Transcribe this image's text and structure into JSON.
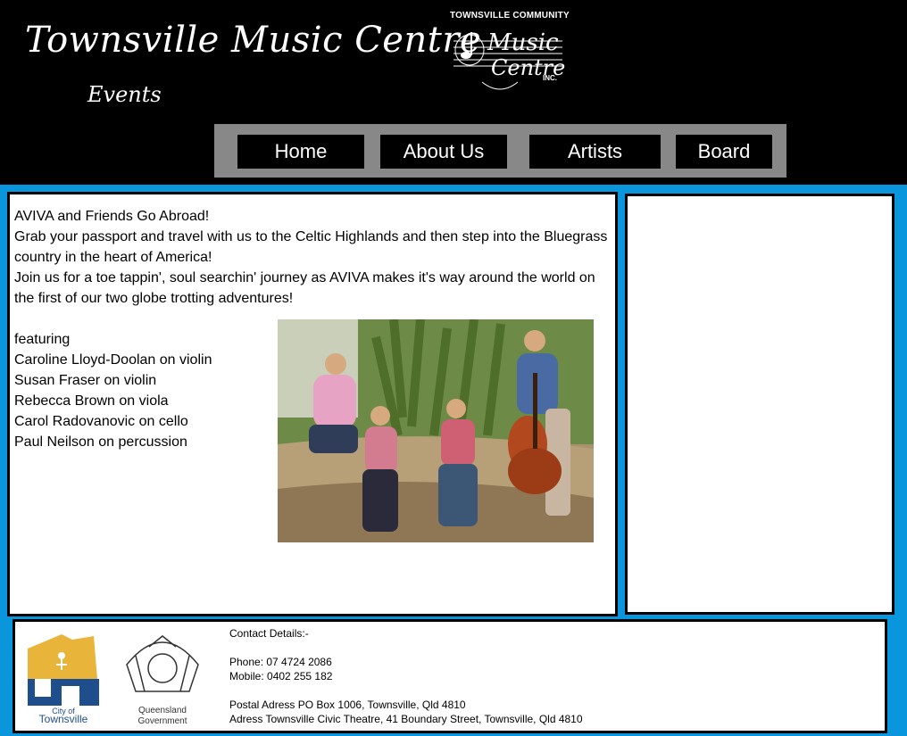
{
  "header": {
    "title": "Townsville Music Centre",
    "subtitle": "Events",
    "logo": {
      "top_text": "TOWNSVILLE COMMUNITY",
      "line1": "Music",
      "line2": "Centre",
      "suffix": "INC."
    }
  },
  "nav": {
    "items": [
      {
        "label": "Home"
      },
      {
        "label": "About Us"
      },
      {
        "label": "Artists"
      },
      {
        "label": "Board"
      }
    ]
  },
  "main": {
    "lines": [
      "AVIVA and Friends Go Abroad!",
      "Grab your passport and travel with us to the Celtic Highlands and then step into the Bluegrass country in the heart of America!",
      "Join us for a toe tappin', soul searchin' journey as AVIVA makes it's way around the world on the first of our two globe trotting adventures!"
    ],
    "featuring_label": "featuring",
    "performers": [
      "Caroline Lloyd-Doolan on violin",
      "Susan Fraser on violin",
      "Rebecca Brown on viola",
      "Carol Radovanovic on cello",
      "Paul Neilson on percussion"
    ]
  },
  "footer": {
    "contact_heading": "Contact Details:-",
    "phone": "Phone: 07 4724 2086",
    "mobile": "Mobile: 0402 255 182",
    "postal": "Postal Adress PO Box 1006, Townsville, Qld 4810",
    "address": "Adress Townsville Civic Theatre, 41 Boundary Street, Townsville, Qld 4810",
    "city_logo": {
      "line1": "City of",
      "line2": "Townsville"
    },
    "qld_logo": {
      "line1": "Queensland",
      "line2": "Government"
    }
  },
  "colors": {
    "background": "#0a96dc",
    "header": "#000000",
    "nav_bar": "#888888",
    "city_gold": "#e8b53a",
    "city_blue": "#1f4e8c"
  }
}
